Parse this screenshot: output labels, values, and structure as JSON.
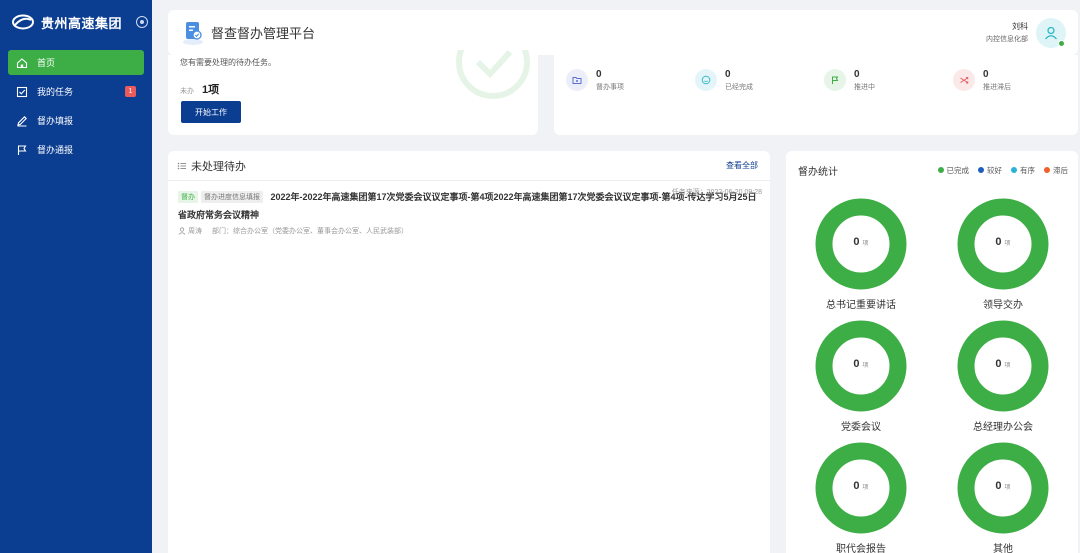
{
  "sidebar": {
    "brand": "贵州高速集团",
    "items": [
      {
        "label": "首页",
        "icon": "home-icon",
        "active": true
      },
      {
        "label": "我的任务",
        "icon": "checkbox-icon",
        "badge": "1"
      },
      {
        "label": "督办填报",
        "icon": "pen-icon"
      },
      {
        "label": "督办通报",
        "icon": "flag-icon"
      }
    ]
  },
  "header": {
    "title": "督查督办管理平台",
    "user_name": "刘科",
    "user_dept": "内控信息化部"
  },
  "welcome": {
    "message": "您有需要处理的待办任务。",
    "pending_label": "未办",
    "pending_count": "1项",
    "start_button": "开始工作"
  },
  "stats": [
    {
      "value": "0",
      "label": "督办事项",
      "icon": "folder-icon",
      "color": "#5b6fd6",
      "bg": "#eceffa"
    },
    {
      "value": "0",
      "label": "已经完成",
      "icon": "smile-icon",
      "color": "#3bb8c9",
      "bg": "#e3f5f8"
    },
    {
      "value": "0",
      "label": "推进中",
      "icon": "flag-icon",
      "color": "#3dae46",
      "bg": "#e7f5e8"
    },
    {
      "value": "0",
      "label": "推进滞后",
      "icon": "shuffle-icon",
      "color": "#e46060",
      "bg": "#fbe9e9"
    }
  ],
  "todo": {
    "title": "未处理待办",
    "more": "查看全部",
    "task": {
      "tag1": "督办",
      "tag2": "督办进度信息填报",
      "title": "2022年-2022年高速集团第17次党委会议议定事项-第4项2022年高速集团第17次党委会议议定事项-第4项-传达学习5月25日省政府常务会议精神",
      "time": "任务来源：2022-06-20 09:28",
      "person": "周涛",
      "dept": "部门：综合办公室（党委办公室、董事会办公室、人民武装部）"
    }
  },
  "statistics": {
    "title": "督办统计",
    "legend": [
      {
        "label": "已完成",
        "color": "#3dae46"
      },
      {
        "label": "较好",
        "color": "#1f5fbf"
      },
      {
        "label": "有序",
        "color": "#28b4d8"
      },
      {
        "label": "滞后",
        "color": "#f0602a"
      }
    ],
    "unit": "项",
    "donuts": [
      {
        "label": "总书记重要讲话",
        "value": "0"
      },
      {
        "label": "领导交办",
        "value": "0"
      },
      {
        "label": "党委会议",
        "value": "0"
      },
      {
        "label": "总经理办公会",
        "value": "0"
      },
      {
        "label": "职代会报告",
        "value": "0"
      },
      {
        "label": "其他",
        "value": "0"
      }
    ]
  }
}
